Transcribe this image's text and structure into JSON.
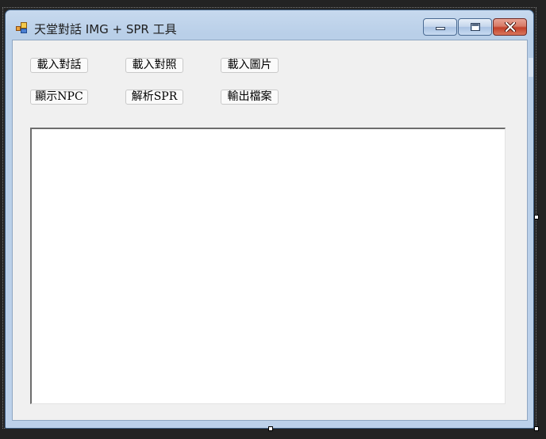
{
  "window": {
    "title": "天堂對話 IMG + SPR 工具",
    "icon": "form-icon"
  },
  "caption": {
    "minimize_icon": "minimize-icon",
    "maximize_icon": "maximize-icon",
    "close_icon": "close-icon"
  },
  "buttons": {
    "load_dialog": "載入對話",
    "load_compare": "載入對照",
    "load_image": "載入圖片",
    "show_npc": "顯示NPC",
    "parse_spr": "解析SPR",
    "export_file": "輸出檔案"
  },
  "textbox": {
    "value": ""
  },
  "colors": {
    "titlebar": "#bcd1ea",
    "client_bg": "#f0f0f0",
    "close_button": "#c2402a"
  }
}
